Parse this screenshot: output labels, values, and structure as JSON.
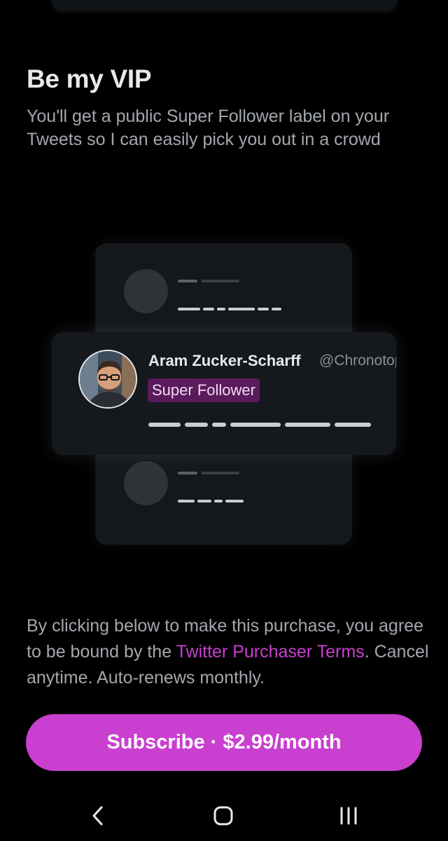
{
  "section": {
    "title": "Be my VIP",
    "description": "You'll get a public Super Follower label on your Tweets so I can easily pick you out in a crowd"
  },
  "preview": {
    "user_name": "Aram Zucker-Scharff",
    "user_handle": "@Chronotope",
    "badge_label": "Super Follower"
  },
  "legal": {
    "part1": "By clicking below to make this purchase, you agree to be bound by the ",
    "link": "Twitter Purchaser Terms",
    "part2": ". Cancel anytime. Auto-renews monthly."
  },
  "subscribe_button": {
    "label": "Subscribe · $2.99/month"
  },
  "navbar": {
    "back_icon": "chevron-left-icon",
    "home_icon": "home-square-icon",
    "recents_icon": "recent-apps-icon"
  },
  "colors": {
    "accent": "#c93fcf",
    "badge_bg": "#5a1b5c",
    "background": "#000000"
  }
}
